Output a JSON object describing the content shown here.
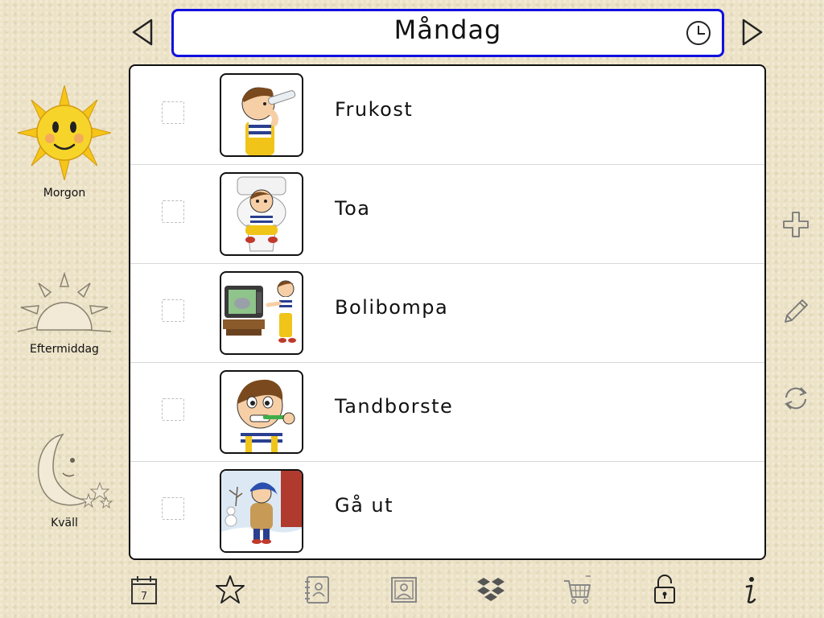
{
  "header": {
    "day_title": "Måndag"
  },
  "sidebar": {
    "periods": [
      {
        "label": "Morgon",
        "icon": "sun-icon"
      },
      {
        "label": "Eftermiddag",
        "icon": "setting-sun-icon"
      },
      {
        "label": "Kväll",
        "icon": "moon-icon"
      }
    ]
  },
  "activities": [
    {
      "label": "Frukost",
      "icon": "boy-drinking-icon",
      "checked": false
    },
    {
      "label": "Toa",
      "icon": "boy-on-toilet-icon",
      "checked": false
    },
    {
      "label": "Bolibompa",
      "icon": "boy-watching-tv-icon",
      "checked": false
    },
    {
      "label": "Tandborste",
      "icon": "boy-brushing-teeth-icon",
      "checked": false
    },
    {
      "label": "Gå ut",
      "icon": "boy-in-snow-icon",
      "checked": false
    }
  ],
  "calendar_icon_number": "7",
  "colors": {
    "accent_border": "#1010e0",
    "background": "#ece2c6",
    "icon_stroke": "#555555"
  }
}
